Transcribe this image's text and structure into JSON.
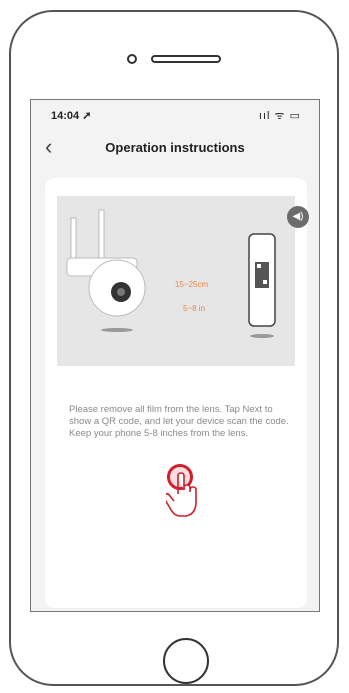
{
  "status_bar": {
    "time": "14:04 ➚",
    "icons": "ııl ᯤ ▭"
  },
  "nav": {
    "back_icon": "‹",
    "title": "Operation instructions"
  },
  "illustration": {
    "distance_cm": "15~25cm",
    "distance_in": "5~8 in",
    "sound_icon": "◀)"
  },
  "instruction_text": "Please remove all film from the lens. Tap Next to show a QR code, and let your device scan the code. Keep your phone 5-8 inches from the lens.",
  "next_button": {
    "label": ""
  },
  "colors": {
    "accent_button": "#5aa9d8",
    "distance_text": "#e58a4a",
    "tap_indicator": "#d21f2e"
  }
}
